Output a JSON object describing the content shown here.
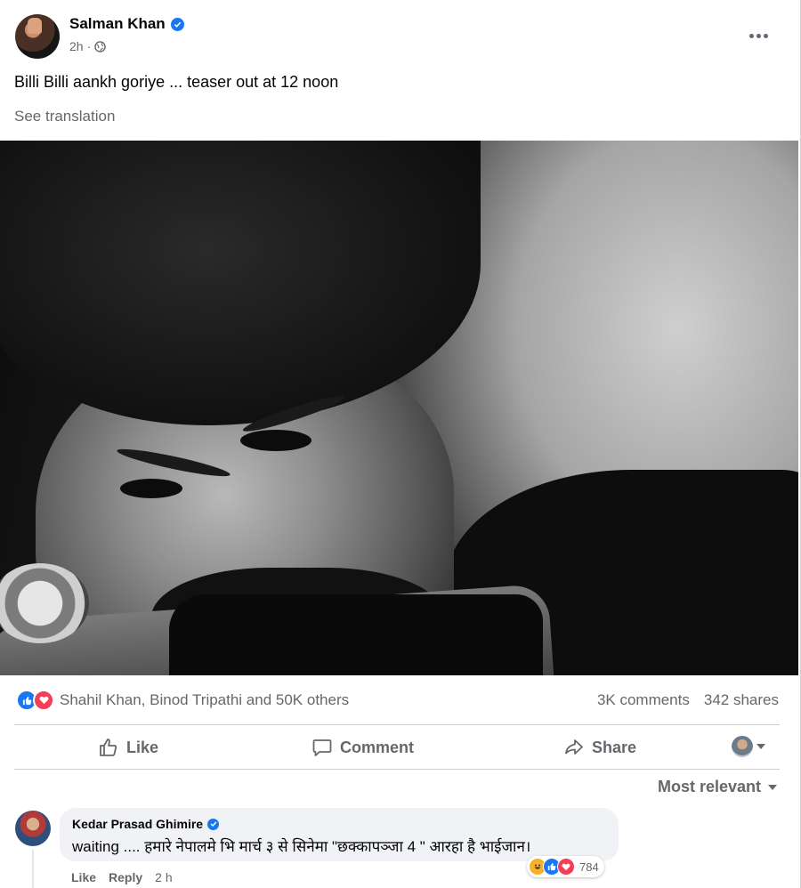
{
  "post": {
    "author": "Salman Khan",
    "time": "2h",
    "text": "Billi Billi aankh goriye ... teaser out at 12 noon",
    "see_translation": "See translation"
  },
  "reactions": {
    "names": "Shahil Khan, Binod Tripathi and 50K others",
    "comments": "3K comments",
    "shares": "342 shares"
  },
  "actions": {
    "like": "Like",
    "comment": "Comment",
    "share": "Share"
  },
  "sort": "Most relevant",
  "comment": {
    "author": "Kedar Prasad Ghimire",
    "text": "waiting .... हमारे नेपालमे भि मार्च ३ से सिनेमा \"छक्कापञ्जा 4 \" आरहा है भाईजान।",
    "reaction_count": "784",
    "like": "Like",
    "reply": "Reply",
    "time": "2 h"
  },
  "colors": {
    "accent": "#1877f2",
    "love": "#f33e58",
    "muted_text": "#65676b"
  }
}
